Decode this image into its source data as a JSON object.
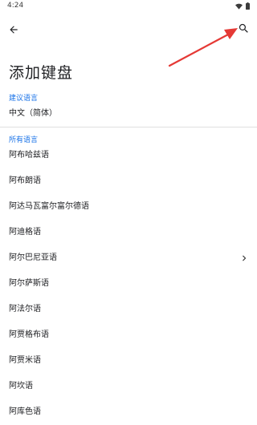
{
  "status_bar": {
    "time": "4:24"
  },
  "app_bar": {
    "back_icon": "arrow-back-icon",
    "search_icon": "search-icon"
  },
  "page": {
    "title": "添加键盘"
  },
  "suggested": {
    "header": "建议语言",
    "items": [
      {
        "label": "中文（简体）"
      }
    ]
  },
  "all_languages": {
    "header": "所有语言",
    "items": [
      {
        "label": "阿布哈兹语",
        "has_chevron": false
      },
      {
        "label": "阿布朗语",
        "has_chevron": false
      },
      {
        "label": "阿达马瓦富尔富尔德语",
        "has_chevron": false
      },
      {
        "label": "阿迪格语",
        "has_chevron": false
      },
      {
        "label": "阿尔巴尼亚语",
        "has_chevron": true
      },
      {
        "label": "阿尔萨斯语",
        "has_chevron": false
      },
      {
        "label": "阿法尔语",
        "has_chevron": false
      },
      {
        "label": "阿贾格布语",
        "has_chevron": false
      },
      {
        "label": "阿贾米语",
        "has_chevron": false
      },
      {
        "label": "阿坎语",
        "has_chevron": false
      },
      {
        "label": "阿库色语",
        "has_chevron": false
      }
    ]
  },
  "colors": {
    "accent": "#1a73e8",
    "annotation_arrow": "#e53935",
    "text_primary": "#202124",
    "divider": "#e0e0e0"
  }
}
